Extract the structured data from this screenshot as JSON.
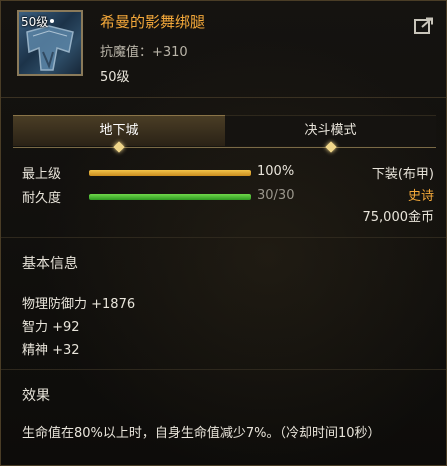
{
  "item": {
    "icon_level": "50级",
    "name": "希曼的影舞绑腿",
    "resist": "抗魔值：+310",
    "level": "50级"
  },
  "icons": {
    "share": "share-icon",
    "tab_marker": "diamond-icon"
  },
  "tabs": [
    {
      "label": "地下城",
      "active": true
    },
    {
      "label": "决斗模式",
      "active": false
    }
  ],
  "stats": {
    "upgrade": {
      "label": "最上级",
      "value": "100%",
      "fill": 1.0
    },
    "durability": {
      "label": "耐久度",
      "value": "30/30",
      "fill": 1.0
    }
  },
  "info": {
    "slot": "下装(布甲)",
    "rarity": "史诗",
    "price": "75,000金币"
  },
  "basic": {
    "title": "基本信息",
    "lines": [
      "物理防御力 +1876",
      "智力 +92",
      "精神 +32"
    ]
  },
  "effect": {
    "title": "效果",
    "text": "生命值在80%以上时，自身生命值减少7%。（冷却时间10秒）"
  },
  "colors": {
    "name": "#f4a83a",
    "rarity": "#f4a83a",
    "gold_bar": "#e2a832",
    "green_bar": "#4fc236",
    "tab_active": "#3a2f1d",
    "background": "#12100d"
  }
}
